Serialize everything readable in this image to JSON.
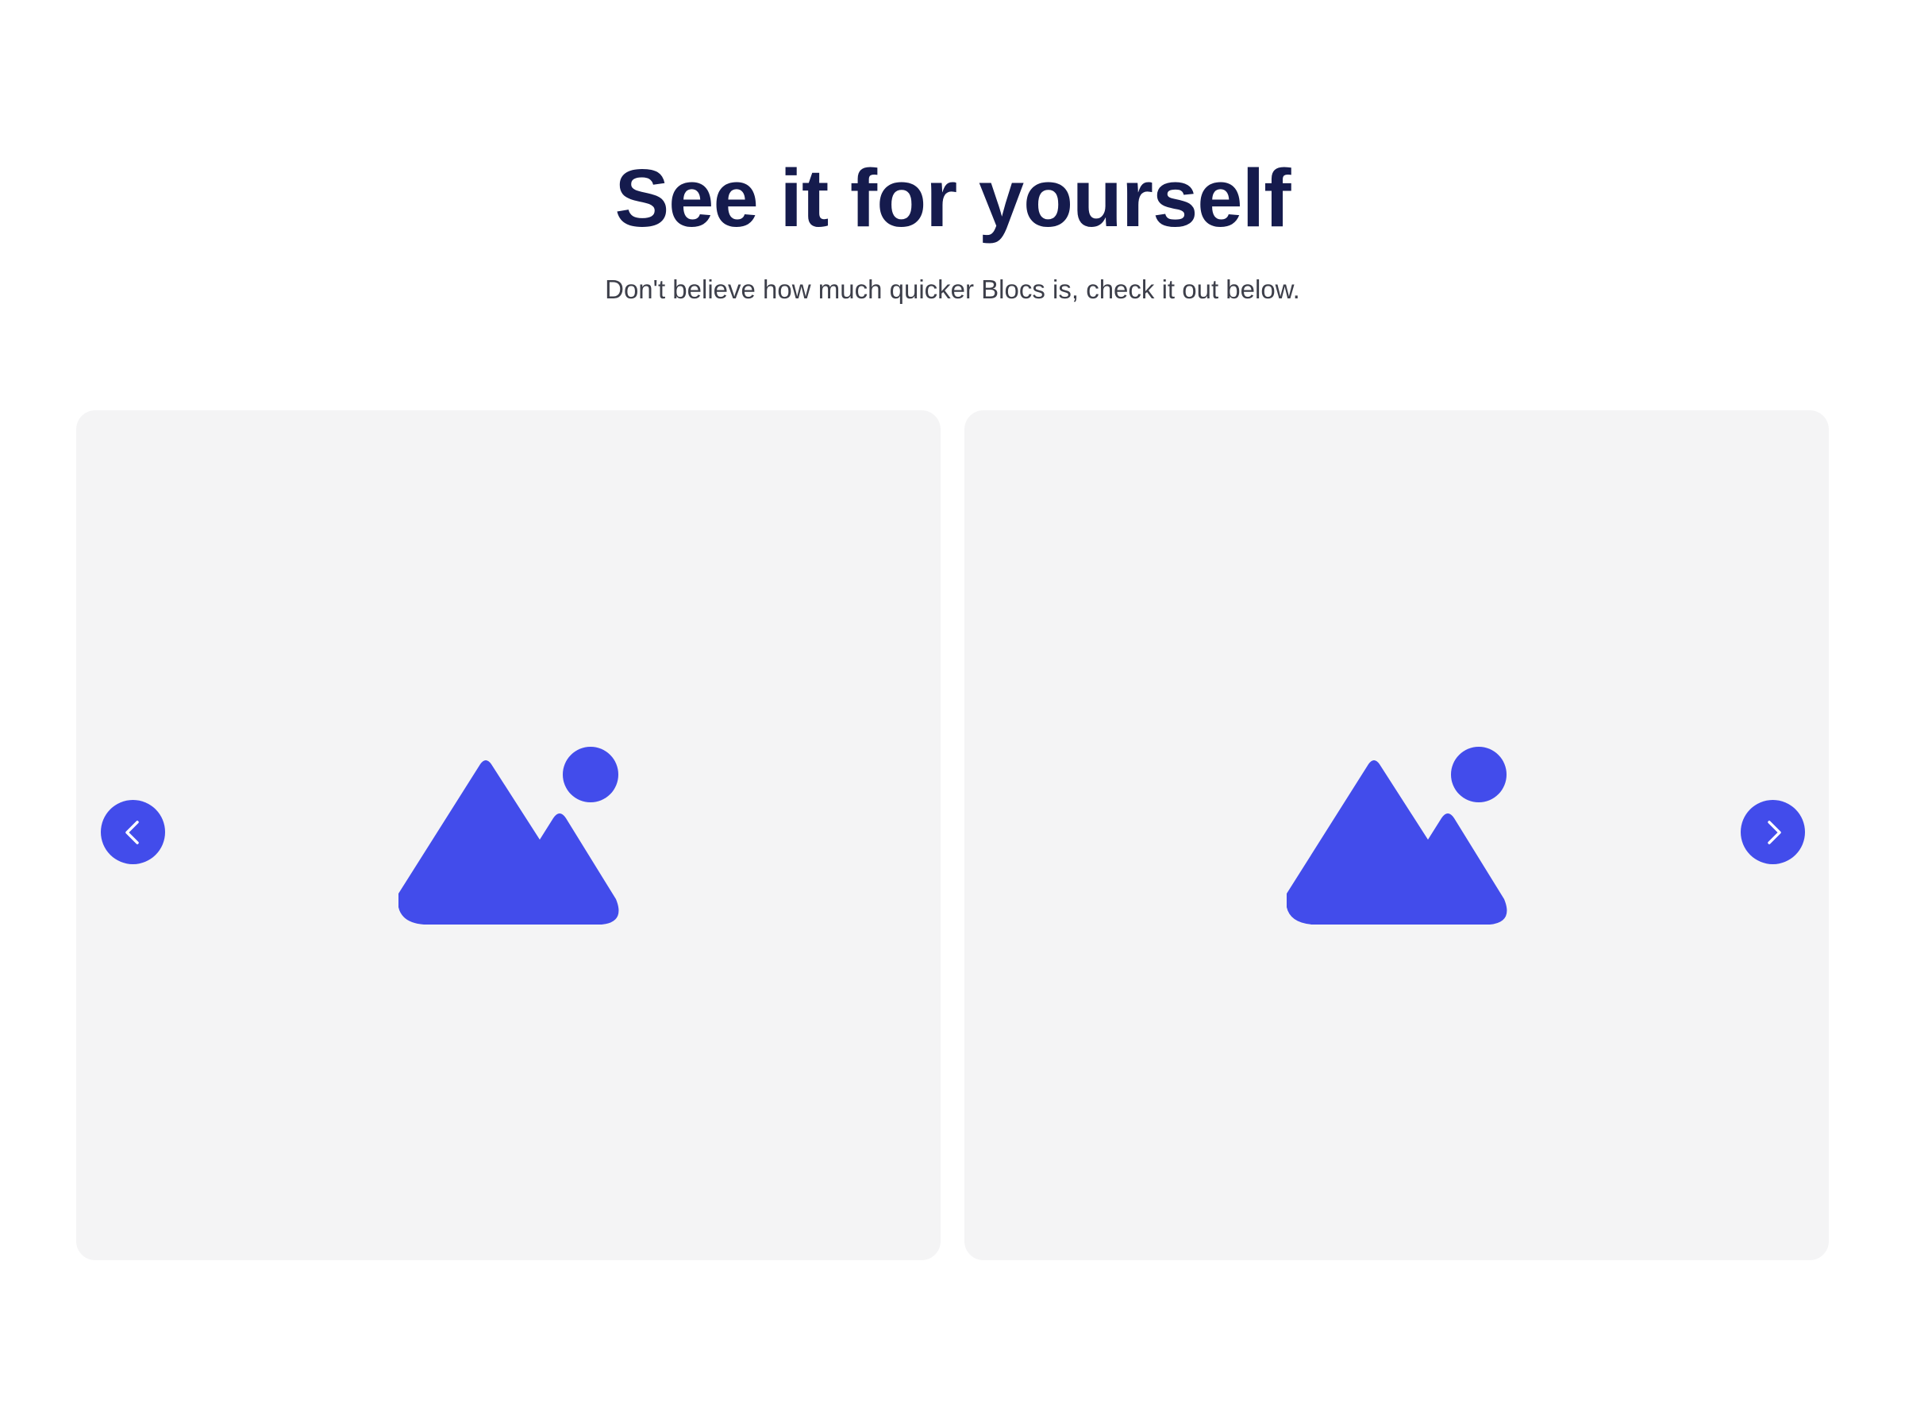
{
  "section": {
    "title": "See it for yourself",
    "subtitle": "Don't believe how much quicker Blocs is, check it out below."
  },
  "carousel": {
    "slides": [
      {
        "icon": "image-placeholder-icon"
      },
      {
        "icon": "image-placeholder-icon"
      }
    ],
    "prev_icon": "chevron-left-icon",
    "next_icon": "chevron-right-icon"
  },
  "colors": {
    "heading": "#151b4d",
    "body_text": "#3d3f4a",
    "accent": "#424ceb",
    "slide_background": "#f4f4f5",
    "page_background": "#ffffff"
  }
}
